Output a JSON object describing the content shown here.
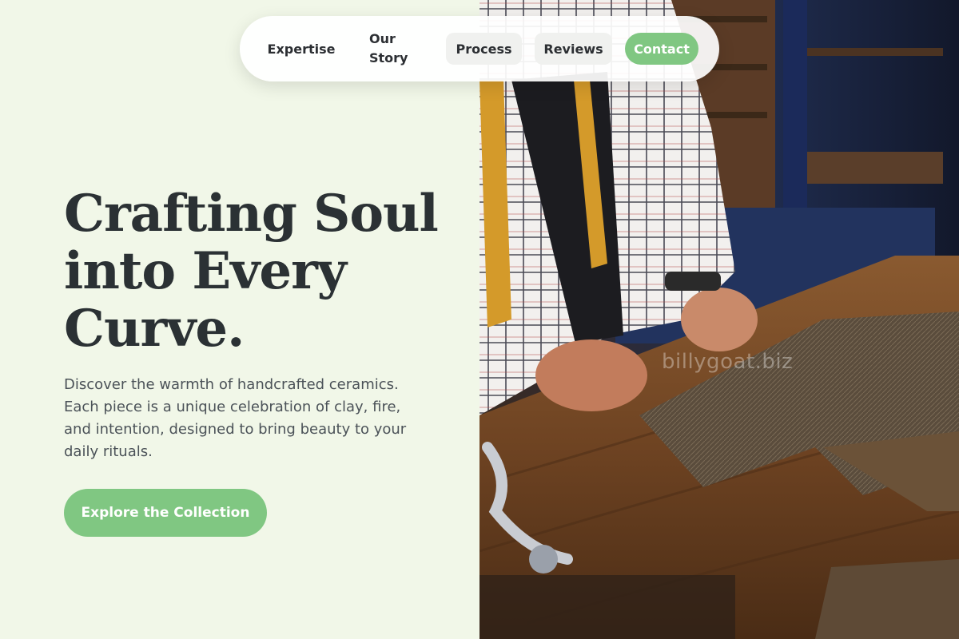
{
  "nav": {
    "items": [
      {
        "label": "Expertise"
      },
      {
        "label": "Our Story"
      },
      {
        "label": "Process"
      },
      {
        "label": "Reviews"
      },
      {
        "label": "Contact"
      }
    ]
  },
  "hero": {
    "title": "Crafting Soul into Every Curve.",
    "subtitle": "Discover the warmth of handcrafted ceramics. Each piece is a unique celebration of clay, fire, and intention, designed to bring beauty to your daily rituals.",
    "cta_label": "Explore the Collection"
  },
  "photo": {
    "watermark": "billygoat.biz",
    "subject": "tailor-cutting-tweed-fabric"
  },
  "colors": {
    "background": "#f1f7e8",
    "accent": "#80c782",
    "text_dark": "#2b3134",
    "text_muted": "#4b5258"
  }
}
